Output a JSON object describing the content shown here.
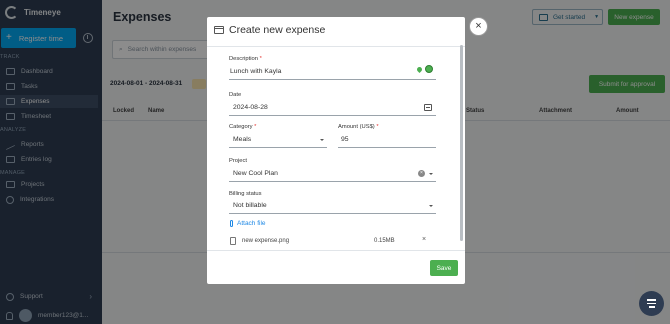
{
  "app": {
    "name": "Timeneye",
    "register_label": "Register time"
  },
  "sidebar": {
    "sections": {
      "track": "TRACK",
      "analyze": "ANALYZE",
      "manage": "MANAGE"
    },
    "items": [
      {
        "label": "Dashboard",
        "icon": "dashboard-icon"
      },
      {
        "label": "Tasks",
        "icon": "tasks-icon"
      },
      {
        "label": "Expenses",
        "icon": "expenses-icon",
        "active": true
      },
      {
        "label": "Timesheet",
        "icon": "timesheet-icon"
      },
      {
        "label": "Reports",
        "icon": "reports-icon"
      },
      {
        "label": "Entries log",
        "icon": "entries-log-icon"
      },
      {
        "label": "Projects",
        "icon": "projects-icon"
      },
      {
        "label": "Integrations",
        "icon": "integrations-icon"
      }
    ],
    "support_label": "Support",
    "user_email": "member123@1..."
  },
  "page": {
    "title": "Expenses",
    "get_started_label": "Get started",
    "new_expense_label": "New expense",
    "search_placeholder": "Search within expenses",
    "date_range": "2024-08-01 - 2024-08-31",
    "submit_label": "Submit for approval",
    "columns": {
      "locked": "Locked",
      "name": "Name",
      "billing_status": "ng Status",
      "attachment": "Attachment",
      "amount": "Amount"
    }
  },
  "modal": {
    "title": "Create new expense",
    "description": {
      "label": "Description",
      "required": "*",
      "value": "Lunch with Kayla"
    },
    "date": {
      "label": "Date",
      "value": "2024-08-28"
    },
    "category": {
      "label": "Category",
      "required": "*",
      "value": "Meals"
    },
    "amount": {
      "label": "Amount (US$)",
      "required": "*",
      "value": "95"
    },
    "project": {
      "label": "Project",
      "value": "New Cool Plan"
    },
    "billing": {
      "label": "Billing status",
      "value": "Not billable"
    },
    "attach_label": "Attach file",
    "file": {
      "name": "new expense.png",
      "size": "0.15MB",
      "remove": "×"
    },
    "save_label": "Save",
    "close_label": "×"
  },
  "colors": {
    "sidebar_bg": "#2e3c52",
    "primary_blue": "#03a9f4",
    "success_green": "#4caf50",
    "required_red": "#e53935"
  }
}
